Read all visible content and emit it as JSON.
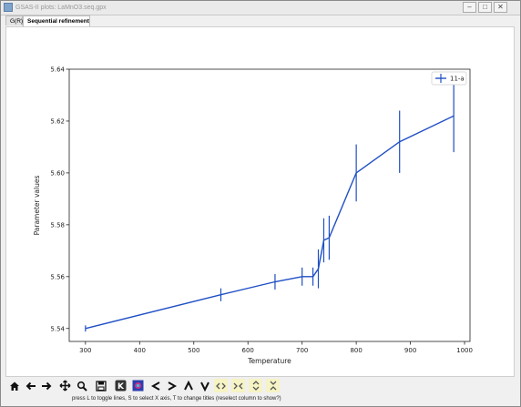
{
  "window": {
    "title": "GSAS-II plots: LaMnO3.seq.gpx",
    "buttons": {
      "minimize": "–",
      "maximize": "□",
      "close": "✕"
    }
  },
  "tabs": [
    {
      "label": "G(R)"
    },
    {
      "label": "Sequential refinement"
    }
  ],
  "toolbar": {
    "icons": [
      "home-icon",
      "back-arrow-icon",
      "forward-arrow-icon",
      "pan-icon",
      "zoom-icon",
      "save-icon",
      "k-key-icon",
      "palette-icon",
      "less-than-icon",
      "greater-than-icon",
      "caret-up-icon",
      "caret-down-icon",
      "expand-h-icon",
      "shrink-h-icon",
      "expand-v-icon",
      "shrink-v-icon"
    ]
  },
  "status": {
    "text": "press L to toggle lines, S to select X axis, T to change titles (reselect column to show?)"
  },
  "chart_data": {
    "type": "line",
    "xlabel": "Temperature",
    "ylabel": "Parameter values",
    "xlim": [
      270,
      1010
    ],
    "ylim": [
      5.535,
      5.64
    ],
    "xticks": [
      300,
      400,
      500,
      600,
      700,
      800,
      900,
      1000
    ],
    "yticks": [
      5.54,
      5.56,
      5.58,
      5.6,
      5.62,
      5.64
    ],
    "ytick_labels": [
      "5.54",
      "5.56",
      "5.58",
      "5.60",
      "5.62",
      "5.64"
    ],
    "grid": false,
    "legend": "top-right",
    "color": "#1f4fc4",
    "series": [
      {
        "name": "11-a",
        "x": [
          300,
          550,
          650,
          700,
          720,
          730,
          740,
          750,
          800,
          880,
          980
        ],
        "y": [
          5.54,
          5.553,
          5.558,
          5.56,
          5.56,
          5.563,
          5.574,
          5.575,
          5.6,
          5.612,
          5.622
        ],
        "err": [
          0.0012,
          0.0025,
          0.003,
          0.0035,
          0.0035,
          0.0075,
          0.0085,
          0.0085,
          0.011,
          0.012,
          0.014
        ]
      }
    ]
  }
}
